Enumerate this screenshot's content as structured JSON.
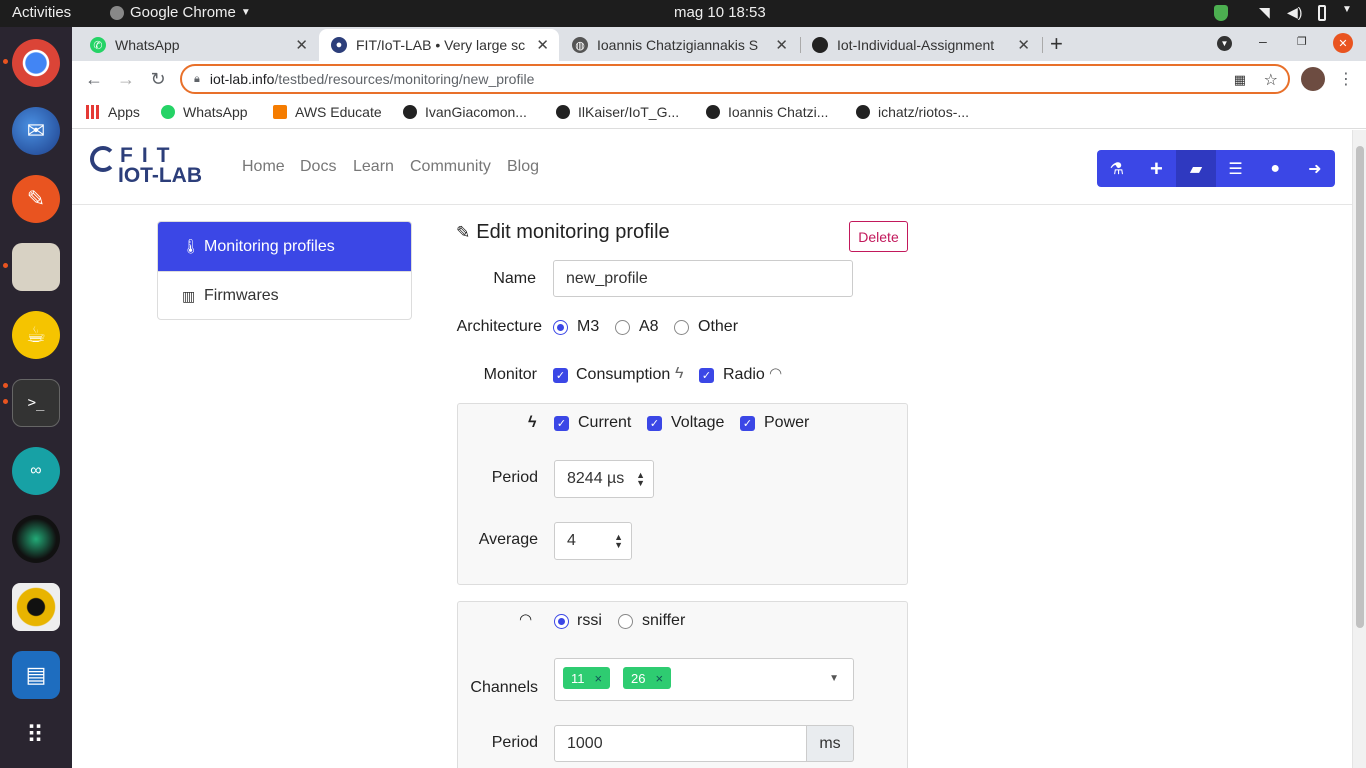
{
  "topbar": {
    "activities": "Activities",
    "app": "Google Chrome",
    "clock": "mag 10  18:53"
  },
  "tabs": [
    {
      "title": "WhatsApp",
      "color": "#25d366"
    },
    {
      "title": "FIT/IoT-LAB • Very large sc",
      "color": "#2c3e7a"
    },
    {
      "title": "Ioannis Chatzigiannakis S",
      "color": "#555555"
    },
    {
      "title": "Iot-Individual-Assignment",
      "color": "#222222"
    }
  ],
  "address": {
    "host": "iot-lab.info",
    "path": "/testbed/resources/monitoring/new_profile"
  },
  "bookmarks": [
    {
      "label": "Apps"
    },
    {
      "label": "WhatsApp"
    },
    {
      "label": "AWS Educate"
    },
    {
      "label": "IvanGiacomon..."
    },
    {
      "label": "IlKaiser/IoT_G..."
    },
    {
      "label": "Ioannis Chatzi..."
    },
    {
      "label": "ichatz/riotos-..."
    }
  ],
  "site": {
    "logo_line1": "FIT",
    "logo_line2": "IOT-LAB",
    "nav": [
      "Home",
      "Docs",
      "Learn",
      "Community",
      "Blog"
    ],
    "tools": [
      "flask-icon",
      "plus-icon",
      "folder-open-icon",
      "list-icon",
      "user-icon",
      "logout-icon"
    ]
  },
  "sidebar": {
    "items": [
      "Monitoring profiles",
      "Firmwares"
    ]
  },
  "form": {
    "title": "Edit monitoring profile",
    "delete": "Delete",
    "name_label": "Name",
    "name_value": "new_profile",
    "arch_label": "Architecture",
    "arch_options": [
      "M3",
      "A8",
      "Other"
    ],
    "arch_selected": "M3",
    "monitor_label": "Monitor",
    "monitor_options": [
      "Consumption",
      "Radio"
    ],
    "consumption": {
      "options": [
        "Current",
        "Voltage",
        "Power"
      ],
      "period_label": "Period",
      "period_value": "8244 µs",
      "average_label": "Average",
      "average_value": "4"
    },
    "radio": {
      "modes": [
        "rssi",
        "sniffer"
      ],
      "mode_selected": "rssi",
      "channels_label": "Channels",
      "channels": [
        "11",
        "26"
      ],
      "period_label": "Period",
      "period_value": "1000",
      "period_unit": "ms"
    }
  },
  "colors": {
    "primary": "#3b47e6",
    "danger": "#c2185b",
    "tag": "#2ecc71",
    "omnibox_focus": "#e8702a"
  }
}
